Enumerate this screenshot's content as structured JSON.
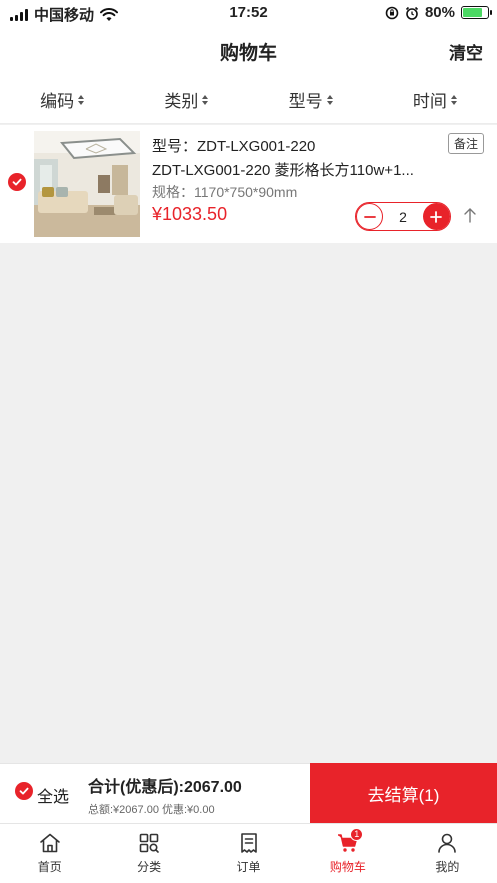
{
  "status_bar": {
    "carrier": "中国移动",
    "time": "17:52",
    "battery": "80%"
  },
  "header": {
    "title": "购物车",
    "clear_label": "清空"
  },
  "sort_bar": {
    "items": [
      {
        "label": "编码"
      },
      {
        "label": "类别"
      },
      {
        "label": "型号"
      },
      {
        "label": "时间"
      }
    ]
  },
  "cart": {
    "items": [
      {
        "model": "型号：ZDT-LXG001-220",
        "remark_label": "备注",
        "name": "ZDT-LXG001-220 菱形格长方110w+1...",
        "spec": "规格：1170*750*90mm",
        "price": "¥1033.50",
        "quantity": "2",
        "selected": true
      }
    ]
  },
  "checkout": {
    "select_all_label": "全选",
    "total": "合计(优惠后):2067.00",
    "subtotal": "总额:¥2067.00 优惠:¥0.00",
    "button_label": "去结算(1)"
  },
  "tab_bar": {
    "items": [
      {
        "label": "首页",
        "icon": "home-icon"
      },
      {
        "label": "分类",
        "icon": "category-icon"
      },
      {
        "label": "订单",
        "icon": "order-icon"
      },
      {
        "label": "购物车",
        "icon": "cart-icon",
        "active": true,
        "badge": "1"
      },
      {
        "label": "我的",
        "icon": "user-icon"
      }
    ]
  },
  "colors": {
    "accent": "#e8232a",
    "background": "#f0f0f0",
    "battery": "#4cd964"
  }
}
